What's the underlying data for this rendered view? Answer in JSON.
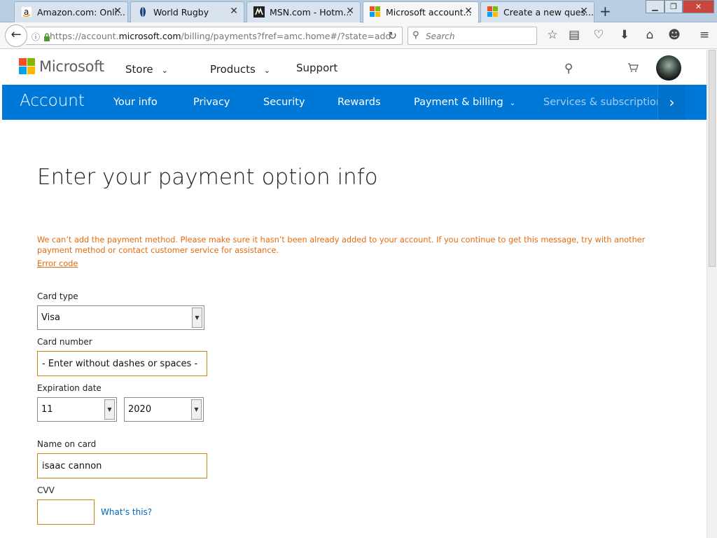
{
  "browser": {
    "tabs": [
      {
        "title": "Amazon.com: Onli...",
        "icon": "amazon-icon"
      },
      {
        "title": "World Rugby",
        "icon": "rugby-icon"
      },
      {
        "title": "MSN.com - Hotm...",
        "icon": "msn-icon"
      },
      {
        "title": "Microsoft account...",
        "icon": "microsoft-icon",
        "active": true
      },
      {
        "title": "Create a new ques...",
        "icon": "microsoft-icon"
      }
    ],
    "url_prefix": "https://account.",
    "url_domain": "microsoft.com",
    "url_path": "/billing/payments?fref=amc.home#/?state=add",
    "search_placeholder": "Search"
  },
  "header": {
    "brand": "Microsoft",
    "nav": [
      {
        "label": "Store"
      },
      {
        "label": "Products"
      },
      {
        "label": "Support"
      }
    ]
  },
  "account_bar": {
    "title": "Account",
    "items": [
      {
        "label": "Your info"
      },
      {
        "label": "Privacy"
      },
      {
        "label": "Security"
      },
      {
        "label": "Rewards"
      },
      {
        "label": "Payment & billing"
      },
      {
        "label": "Services & subscriptions"
      }
    ]
  },
  "form": {
    "title": "Enter your payment option info",
    "error_message": "We can’t add the payment method. Please make sure it hasn’t been already added to your account. If you continue to get this message, try with another payment method or contact customer service for assistance.",
    "error_link": "Error code",
    "card_type_label": "Card type",
    "card_type_value": "Visa",
    "card_number_label": "Card number",
    "card_number_placeholder": "- Enter without dashes or spaces -",
    "expiration_label": "Expiration date",
    "exp_month": "11",
    "exp_year": "2020",
    "name_label": "Name on card",
    "name_value": "isaac cannon",
    "cvv_label": "CVV",
    "cvv_help": "What's this?"
  },
  "colors": {
    "accent_blue": "#0078d7",
    "error_orange": "#e46b0f",
    "link_blue": "#0067b8"
  }
}
